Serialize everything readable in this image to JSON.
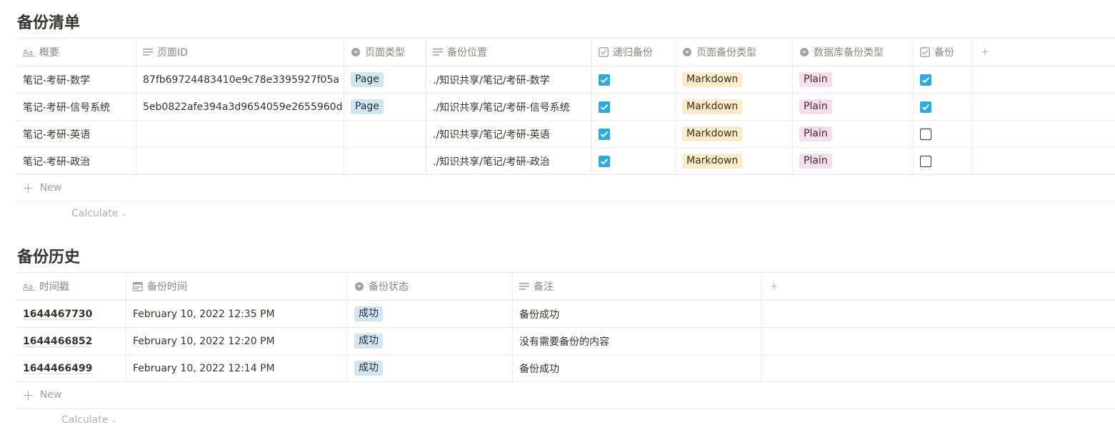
{
  "section1": {
    "title": "备份清单",
    "columns": [
      {
        "label": "概要",
        "icon": "title-aa-icon"
      },
      {
        "label": "页面ID",
        "icon": "text-lines-icon"
      },
      {
        "label": "页面类型",
        "icon": "select-icon"
      },
      {
        "label": "备份位置",
        "icon": "text-lines-icon"
      },
      {
        "label": "递归备份",
        "icon": "checkbox-icon"
      },
      {
        "label": "页面备份类型",
        "icon": "select-icon"
      },
      {
        "label": "数据库备份类型",
        "icon": "select-icon"
      },
      {
        "label": "备份",
        "icon": "checkbox-icon"
      }
    ],
    "add_column": "+",
    "rows": [
      {
        "name": "笔记-考研-数学",
        "page_id": "87fb69724483410e9c78e3395927f05a",
        "page_type": "Page",
        "location": "./知识共享/笔记/考研-数学",
        "recursive": true,
        "page_backup_type": "Markdown",
        "db_backup_type": "Plain",
        "backup": true
      },
      {
        "name": "笔记-考研-信号系统",
        "page_id": "5eb0822afe394a3d9654059e2655960d",
        "page_type": "Page",
        "location": "./知识共享/笔记/考研-信号系统",
        "recursive": true,
        "page_backup_type": "Markdown",
        "db_backup_type": "Plain",
        "backup": true
      },
      {
        "name": "笔记-考研-英语",
        "page_id": "",
        "page_type": "",
        "location": "./知识共享/笔记/考研-英语",
        "recursive": true,
        "page_backup_type": "Markdown",
        "db_backup_type": "Plain",
        "backup": false
      },
      {
        "name": "笔记-考研-政治",
        "page_id": "",
        "page_type": "",
        "location": "./知识共享/笔记/考研-政治",
        "recursive": true,
        "page_backup_type": "Markdown",
        "db_backup_type": "Plain",
        "backup": false
      }
    ],
    "new_label": "New",
    "calculate_label": "Calculate"
  },
  "section2": {
    "title": "备份历史",
    "columns": [
      {
        "label": "时间戳",
        "icon": "title-aa-icon"
      },
      {
        "label": "备份时间",
        "icon": "calendar-icon"
      },
      {
        "label": "备份状态",
        "icon": "select-icon"
      },
      {
        "label": "备注",
        "icon": "text-lines-icon"
      }
    ],
    "add_column": "+",
    "rows": [
      {
        "timestamp": "1644467730",
        "time": "February 10, 2022 12:35 PM",
        "status": "成功",
        "note": "备份成功"
      },
      {
        "timestamp": "1644466852",
        "time": "February 10, 2022 12:20 PM",
        "status": "成功",
        "note": "没有需要备份的内容"
      },
      {
        "timestamp": "1644466499",
        "time": "February 10, 2022 12:14 PM",
        "status": "成功",
        "note": "备份成功"
      }
    ],
    "new_label": "New",
    "calculate_label": "Calculate"
  },
  "colors": {
    "checkbox_on": "#2eaadc",
    "tag_blue": "#d3e5ef",
    "tag_yellow": "#fdecc8",
    "tag_pink": "#f5e0e9"
  }
}
